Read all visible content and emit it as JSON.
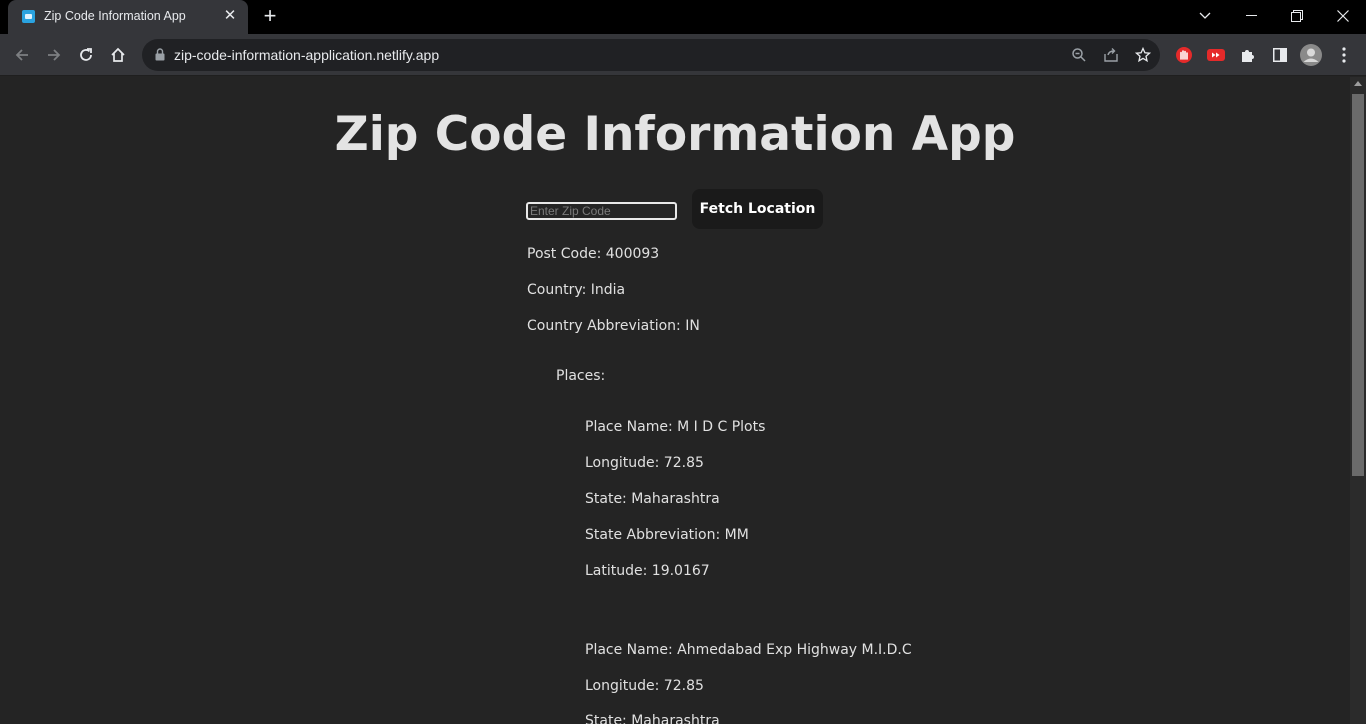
{
  "browser": {
    "tab_title": "Zip Code Information App",
    "url": "zip-code-information-application.netlify.app"
  },
  "page": {
    "title": "Zip Code Information App",
    "input_placeholder": "Enter Zip Code",
    "input_value": "",
    "fetch_button": "Fetch Location",
    "post_code": "Post Code: 400093",
    "country": "Country: India",
    "country_abbreviation": "Country Abbreviation: IN",
    "places_heading": "Places:",
    "places": [
      {
        "name": "Place Name: M I D C Plots",
        "longitude": "Longitude: 72.85",
        "state": "State: Maharashtra",
        "state_abbreviation": "State Abbreviation: MM",
        "latitude": "Latitude: 19.0167"
      },
      {
        "name": "Place Name: Ahmedabad Exp Highway M.I.D.C",
        "longitude": "Longitude: 72.85",
        "state": "State: Maharashtra"
      }
    ]
  },
  "colors": {
    "page_background": "#242424",
    "text": "#e0e0e0",
    "button_background": "#1a1a1a"
  }
}
